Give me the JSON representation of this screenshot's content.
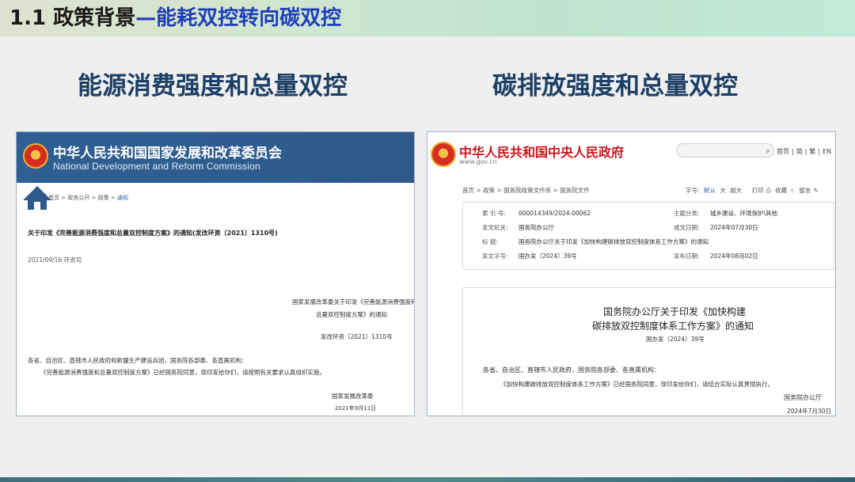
{
  "slide": {
    "title_prefix": "1.1 政策背景",
    "title_emphasis": "—能耗双控转向碳双控",
    "left_heading": "能源消费强度和总量双控",
    "right_heading": "碳排放强度和总量双控"
  },
  "ndrc_page": {
    "agency_cn": "中华人民共和国国家发展和改革委员会",
    "agency_en": "National Development and Reform Commission",
    "breadcrumb_a": "首页 > 政务公开 > 政策 > ",
    "breadcrumb_b": "通知",
    "doc_title": "关于印发《完善能源消费强度和总量双控制度方案》的通知(发改环资〔2021〕1310号)",
    "date": "2021/09/16 环资司",
    "notice_line1": "国家发展改革委关于印发《完善能源消费强度和",
    "notice_line2": "总量双控制度方案》的通知",
    "doc_number": "发改环资〔2021〕1310号",
    "recipients": "各省、自治区、直辖市人民政府和新疆生产建设兵团，国务院各部委、各直属机构：",
    "body": "《完善能源消费强度和总量双控制度方案》已经国务院同意，现印发给你们，请按照有关要求认真组织实施。",
    "signature": "国家发展改革委",
    "sign_date": "2021年9月11日",
    "colors": {
      "banner": "#2f5f93"
    }
  },
  "gov_page": {
    "site_name": "中华人民共和国中央人民政府",
    "site_url": "www.gov.cn",
    "search_icon": "search-icon",
    "nav": [
      "首页",
      "简",
      "繁",
      "EN"
    ],
    "breadcrumb": "首页 > 政策 > 国务院政策文件库 > 国务院文件",
    "toolbar": {
      "font_label": "字号:",
      "font_default": "默认",
      "font_large": "大",
      "font_xlarge": "超大",
      "print": "打印",
      "favorite": "收藏",
      "keep": "留言"
    },
    "meta": {
      "index_key": "索 引 号:",
      "index_val": "000014349/2024-00062",
      "topic_key": "主题分类:",
      "topic_val": "城乡建设、环境保护\\其他",
      "issuer_key": "发文机关:",
      "issuer_val": "国务院办公厅",
      "written_key": "成文日期:",
      "written_val": "2024年07月30日",
      "title_key": "标    题:",
      "title_val": "国务院办公厅关于印发《加快构建碳排放双控制度体系工作方案》的通知",
      "docno_key": "发文字号:",
      "docno_val": "国办发〔2024〕39号",
      "pub_key": "发布日期:",
      "pub_val": "2024年08月02日"
    },
    "doc_title_line1": "国务院办公厅关于印发《加快构建",
    "doc_title_line2": "碳排放双控制度体系工作方案》的通知",
    "doc_number": "国办发〔2024〕39号",
    "recipients": "各省、自治区、直辖市人民政府，国务院各部委、各直属机构：",
    "body": "《加快构建碳排放双控制度体系工作方案》已经国务院同意，现印发给你们，请结合实际认真贯彻执行。",
    "signature": "国务院办公厅",
    "sign_date": "2024年7月30日",
    "colors": {
      "site_name": "#c8161d"
    }
  }
}
